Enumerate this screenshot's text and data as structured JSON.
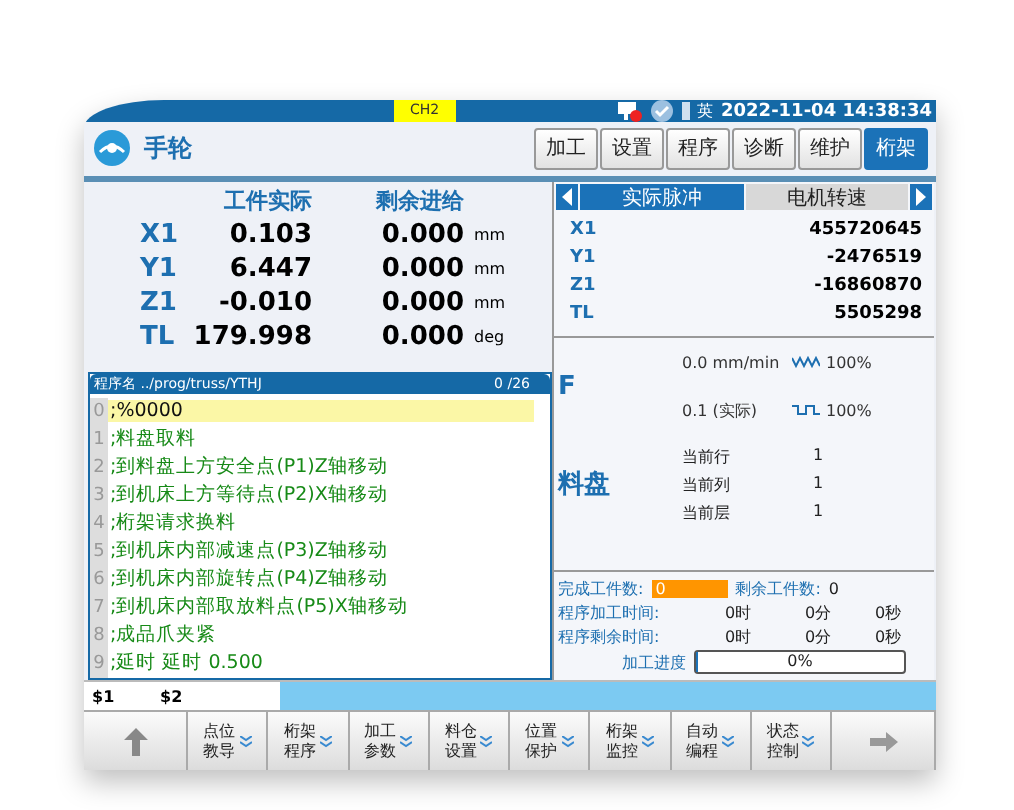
{
  "status_bar": {
    "channel": "CH2",
    "language": "英",
    "datetime": "2022-11-04 14:38:34"
  },
  "header": {
    "mode": "手轮",
    "tabs": [
      {
        "label": "加工",
        "selected": false
      },
      {
        "label": "设置",
        "selected": false
      },
      {
        "label": "程序",
        "selected": false
      },
      {
        "label": "诊断",
        "selected": false
      },
      {
        "label": "维护",
        "selected": false
      },
      {
        "label": "桁架",
        "selected": true
      }
    ]
  },
  "coords": {
    "columns": [
      "工件实际",
      "剩余进给"
    ],
    "rows": [
      {
        "axis": "X1",
        "actual": "0.103",
        "remaining": "0.000",
        "unit": "mm"
      },
      {
        "axis": "Y1",
        "actual": "6.447",
        "remaining": "0.000",
        "unit": "mm"
      },
      {
        "axis": "Z1",
        "actual": "-0.010",
        "remaining": "0.000",
        "unit": "mm"
      },
      {
        "axis": "TL",
        "actual": "179.998",
        "remaining": "0.000",
        "unit": "deg"
      }
    ]
  },
  "program": {
    "title": "程序名 ../prog/truss/YTHJ",
    "position": "0 /26",
    "lines": [
      {
        "number": "0",
        "text": ";%0000",
        "selected": true
      },
      {
        "number": "1",
        "text": ";料盘取料",
        "selected": false
      },
      {
        "number": "2",
        "text": ";到料盘上方安全点(P1)Z轴移动",
        "selected": false
      },
      {
        "number": "3",
        "text": ";到机床上方等待点(P2)X轴移动",
        "selected": false
      },
      {
        "number": "4",
        "text": ";桁架请求换料",
        "selected": false
      },
      {
        "number": "5",
        "text": ";到机床内部减速点(P3)Z轴移动",
        "selected": false
      },
      {
        "number": "6",
        "text": ";到机床内部旋转点(P4)Z轴移动",
        "selected": false
      },
      {
        "number": "7",
        "text": ";到机床内部取放料点(P5)X轴移动",
        "selected": false
      },
      {
        "number": "8",
        "text": ";成品爪夹紧",
        "selected": false
      },
      {
        "number": "9",
        "text": ";延时 延时 0.500",
        "selected": false
      }
    ]
  },
  "pulse_panel": {
    "tabs": [
      {
        "label": "实际脉冲",
        "selected": true
      },
      {
        "label": "电机转速",
        "selected": false
      }
    ],
    "rows": [
      {
        "axis": "X1",
        "value": "455720645"
      },
      {
        "axis": "Y1",
        "value": "-2476519"
      },
      {
        "axis": "Z1",
        "value": "-16860870"
      },
      {
        "axis": "TL",
        "value": "5505298"
      }
    ]
  },
  "feed": {
    "label": "F",
    "rows": [
      {
        "kind": "feed",
        "value": "0.0 mm/min",
        "percent": "100%"
      },
      {
        "kind": "spindle",
        "value": "0.1 (实际)",
        "percent": "100%"
      }
    ]
  },
  "tray": {
    "label": "料盘",
    "rows": [
      {
        "label": "当前行",
        "value": "1"
      },
      {
        "label": "当前列",
        "value": "1"
      },
      {
        "label": "当前层",
        "value": "1"
      }
    ]
  },
  "counts": {
    "done_label": "完成工件数:",
    "done_value": "0",
    "remain_label": "剩余工件数:",
    "remain_value": "0",
    "times": [
      {
        "label": "程序加工时间:",
        "hours": "0时",
        "minutes": "0分",
        "seconds": "0秒"
      },
      {
        "label": "程序剩余时间:",
        "hours": "0时",
        "minutes": "0分",
        "seconds": "0秒"
      }
    ],
    "progress_label": "加工进度",
    "progress_text": "0%",
    "progress": {
      "level": 0.01
    }
  },
  "channels": [
    "$1",
    "$2"
  ],
  "softkeys": [
    {
      "kind": "up"
    },
    {
      "kind": "key",
      "lines": [
        "点位",
        "教导"
      ]
    },
    {
      "kind": "key",
      "lines": [
        "桁架",
        "程序"
      ]
    },
    {
      "kind": "key",
      "lines": [
        "加工",
        "参数"
      ]
    },
    {
      "kind": "key",
      "lines": [
        "料仓",
        "设置"
      ]
    },
    {
      "kind": "key",
      "lines": [
        "位置",
        "保护"
      ]
    },
    {
      "kind": "key",
      "lines": [
        "桁架",
        "监控"
      ]
    },
    {
      "kind": "key",
      "lines": [
        "自动",
        "编程"
      ]
    },
    {
      "kind": "key",
      "lines": [
        "状态",
        "控制"
      ]
    },
    {
      "kind": "right"
    }
  ]
}
